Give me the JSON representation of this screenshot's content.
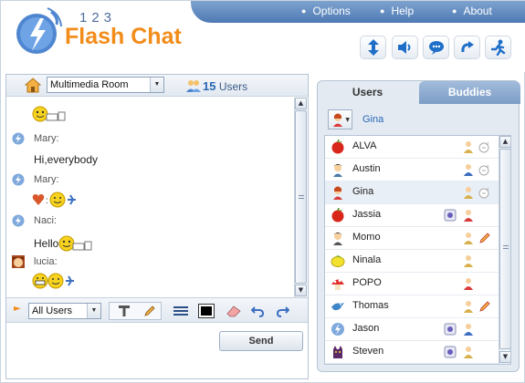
{
  "brand": {
    "numbers": "123",
    "name": "Flash Chat",
    "accent": "#f28c1a",
    "bar": "#5a83bb"
  },
  "topnav": [
    {
      "label": "Options"
    },
    {
      "label": "Help"
    },
    {
      "label": "About"
    }
  ],
  "toolbar": [
    "resize-icon",
    "sound-icon",
    "speech-bubble-icon",
    "redo-arrow-icon",
    "runner-icon"
  ],
  "room": {
    "selected": "Multimedia Room",
    "users_count": "15",
    "users_label": "Users"
  },
  "messages": [
    {
      "type": "smileys",
      "icon": "smiley-face"
    },
    {
      "type": "name",
      "name": "Mary:"
    },
    {
      "type": "text",
      "text": "Hi,everybody"
    },
    {
      "type": "name",
      "name": "Mary:"
    },
    {
      "type": "smileys",
      "icon": "heart-smiley"
    },
    {
      "type": "name",
      "name": "Naci:"
    },
    {
      "type": "text",
      "text": "Hello"
    },
    {
      "type": "name",
      "name": "lucia:"
    },
    {
      "type": "smileys",
      "icon": "grin-smiley"
    }
  ],
  "input": {
    "recipient": "All Users",
    "send_label": "Send"
  },
  "tabs": {
    "users": "Users",
    "buddies": "Buddies"
  },
  "me": {
    "name": "Gina"
  },
  "users": [
    {
      "name": "ALVA",
      "avatar": "apple"
    },
    {
      "name": "Austin",
      "avatar": "man"
    },
    {
      "name": "Gina",
      "avatar": "woman"
    },
    {
      "name": "Jassia",
      "avatar": "apple"
    },
    {
      "name": "Momo",
      "avatar": "man"
    },
    {
      "name": "Ninala",
      "avatar": "lemon"
    },
    {
      "name": "POPO",
      "avatar": "mushroom"
    },
    {
      "name": "Thomas",
      "avatar": "bird"
    },
    {
      "name": "Jason",
      "avatar": "logo"
    },
    {
      "name": "Steven",
      "avatar": "cat"
    }
  ]
}
